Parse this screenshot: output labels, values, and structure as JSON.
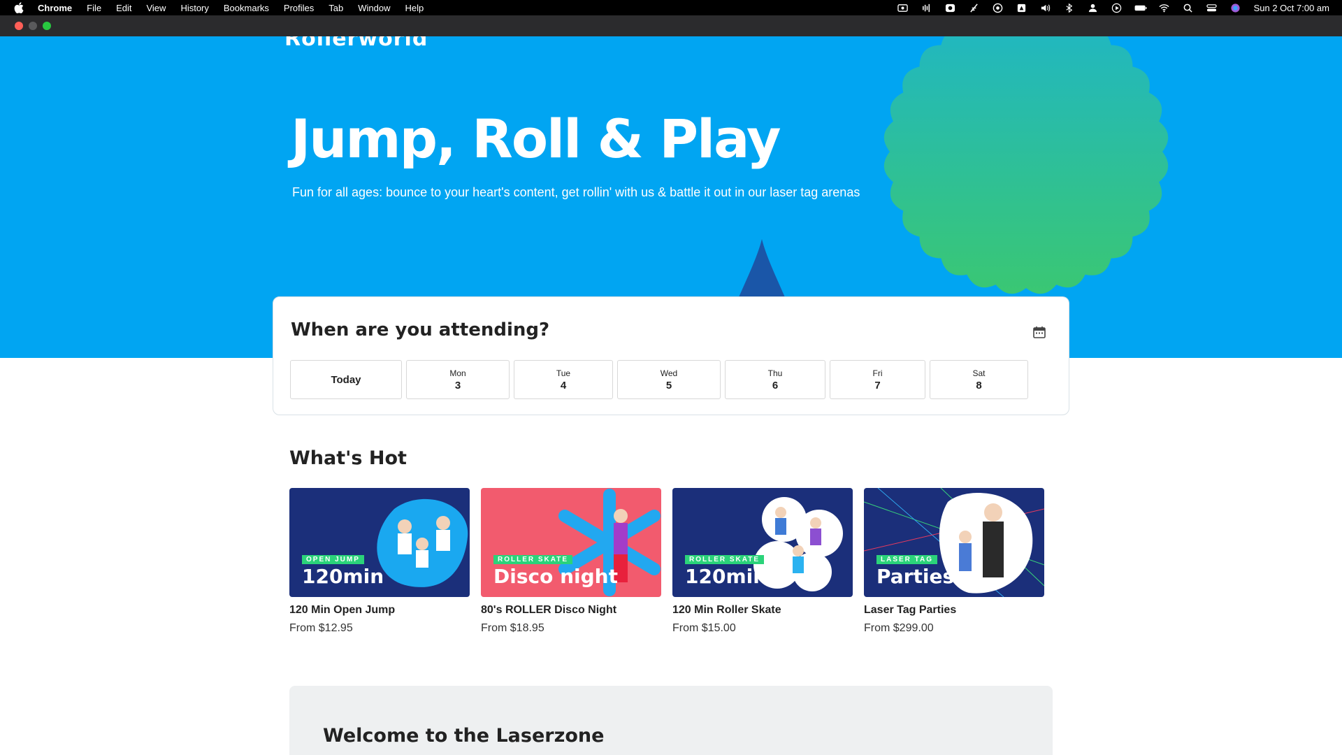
{
  "menubar": {
    "app": "Chrome",
    "items": [
      "File",
      "Edit",
      "View",
      "History",
      "Bookmarks",
      "Profiles",
      "Tab",
      "Window",
      "Help"
    ],
    "clock": "Sun 2 Oct  7:00 am"
  },
  "hero": {
    "logo": "Rollerworld",
    "title": "Jump, Roll & Play",
    "subtitle": "Fun for all ages: bounce to your heart's content, get rollin' with us & battle it out in our laser tag arenas",
    "colors": {
      "background": "#01a5f2",
      "burst": "#34c77b",
      "triangle": "#1a56a8"
    }
  },
  "date_picker": {
    "heading": "When are you attending?",
    "today_label": "Today",
    "days": [
      {
        "dow": "Mon",
        "num": "3"
      },
      {
        "dow": "Tue",
        "num": "4"
      },
      {
        "dow": "Wed",
        "num": "5"
      },
      {
        "dow": "Thu",
        "num": "6"
      },
      {
        "dow": "Fri",
        "num": "7"
      },
      {
        "dow": "Sat",
        "num": "8"
      }
    ],
    "calendar_icon": "calendar-icon"
  },
  "whats_hot": {
    "heading": "What's Hot",
    "cards": [
      {
        "tag": "OPEN JUMP",
        "big": "120min",
        "title": "120 Min Open Jump",
        "price": "From $12.95",
        "bg": "#1b2f7a"
      },
      {
        "tag": "ROLLER SKATE",
        "big": "Disco night",
        "title": "80's ROLLER Disco Night",
        "price": "From $18.95",
        "bg": "#f25b6e"
      },
      {
        "tag": "ROLLER SKATE",
        "big": "120min",
        "title": "120 Min Roller Skate",
        "price": "From $15.00",
        "bg": "#1b2f7a"
      },
      {
        "tag": "LASER TAG",
        "big": "Parties",
        "title": "Laser Tag Parties",
        "price": "From $299.00",
        "bg": "#1b2f7a"
      }
    ]
  },
  "welcome": {
    "heading": "Welcome to the Laserzone"
  }
}
